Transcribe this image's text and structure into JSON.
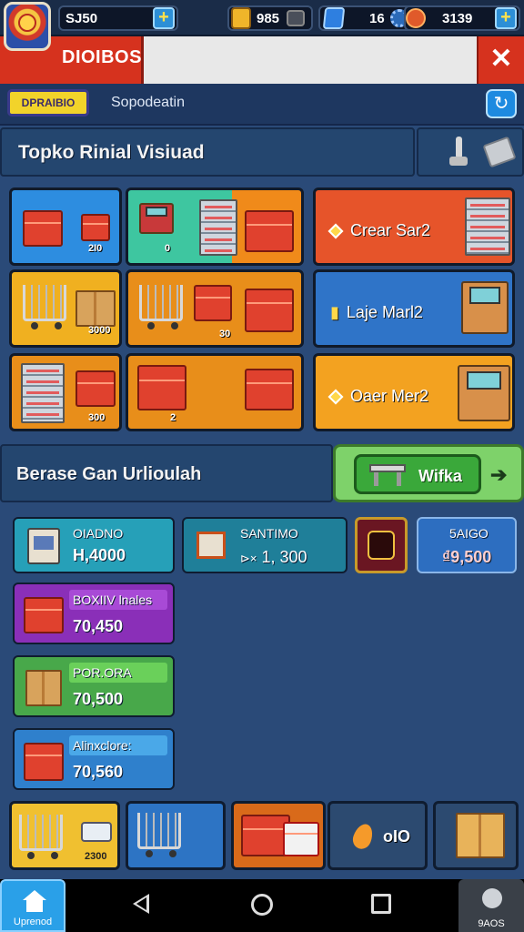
{
  "topbar": {
    "money": "SJ50",
    "coins": "985",
    "gems": "16",
    "tokens": "3139"
  },
  "titlebar": {
    "title": "DIOIBOS"
  },
  "subbar": {
    "badge": "DPRAIBIO",
    "text": "Sopodeatin"
  },
  "section1": {
    "title": "Topko Rinial Visiuad"
  },
  "grid": {
    "tile_1_num": "2I0",
    "tile_2_num": "0",
    "tile_4_num": "3000",
    "tile_5_num": "30",
    "tile_7_num": "300",
    "tile_8_num": "2",
    "row1_label": "Crear Sar2",
    "row2_label": "Laje Marl2",
    "row3_label": "Oaer Mer2"
  },
  "section2": {
    "title": "Berase Gan Urlioulah",
    "button": "Wifka"
  },
  "cards": {
    "c1_name": "OIADNO",
    "c1_value": "H,4000",
    "c2_name": "SANTIMO",
    "c2_value": "1, 300",
    "c2_prefix": "⊳×",
    "c4_name": "5AIGO",
    "c4_value": "₫9,500",
    "c5_name": "BOXIIV lnales",
    "c5_value": "70,450",
    "c6_name": "POR.ORA",
    "c6_value": "70,500",
    "c7_name": "Alinxclore:",
    "c7_value": "70,560"
  },
  "slots": {
    "slot1_num": "2300",
    "slot4_num": "oIO"
  },
  "nav": {
    "home_label": "Uprenod",
    "right_label": "9AOS"
  },
  "colors": {
    "accent_red": "#d6321e",
    "panel_blue": "#24466f",
    "bg_blue": "#2a4a78",
    "button_green": "#3aa83a"
  }
}
